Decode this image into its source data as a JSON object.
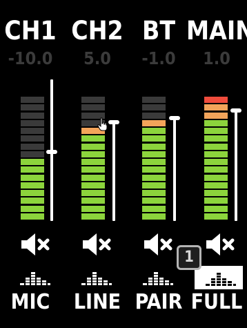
{
  "colors": {
    "green": "#8cd43c",
    "orange": "#f3a45a",
    "red": "#f04c3c",
    "off": "#3a3a3a",
    "gain": "#3b3b3b"
  },
  "channels": [
    {
      "name": "CH1",
      "gain": "-10.0",
      "lit": 8,
      "orange": 0,
      "red": 0,
      "source": "MIC",
      "eq_active": false
    },
    {
      "name": "CH2",
      "gain": "5.0",
      "lit": 12,
      "orange": 1,
      "red": 0,
      "source": "LINE",
      "eq_active": false
    },
    {
      "name": "BT",
      "gain": "-1.0",
      "lit": 13,
      "orange": 1,
      "red": 0,
      "source": "PAIR",
      "eq_active": false
    },
    {
      "name": "MAIN",
      "gain": "1.0",
      "lit": 16,
      "orange": 2,
      "red": 1,
      "source": "FULL",
      "eq_active": true
    }
  ],
  "badge": "1",
  "icons": {
    "mute": "speaker-mute-icon",
    "eq": "equalizer-icon",
    "cursor": "hand-pointer-icon"
  }
}
